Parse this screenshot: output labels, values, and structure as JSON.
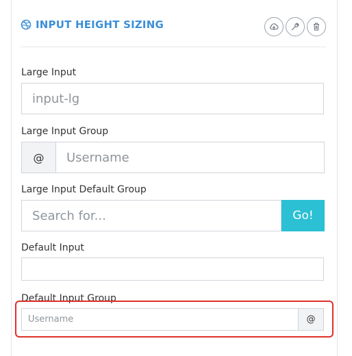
{
  "header": {
    "title": "INPUT HEIGHT SIZING",
    "icons": [
      "dribbble-icon",
      "cloud-upload-icon",
      "wrench-icon",
      "trash-icon"
    ]
  },
  "large_input": {
    "label": "Large Input",
    "placeholder": "input-lg"
  },
  "large_input_group": {
    "label": "Large Input Group",
    "addon": "@",
    "placeholder": "Username"
  },
  "large_default_group": {
    "label": "Large Input Default Group",
    "placeholder": "Search for...",
    "button": "Go!"
  },
  "default_input": {
    "label": "Default Input",
    "placeholder": ""
  },
  "default_input_group": {
    "label": "Default Input Group",
    "placeholder": "Username",
    "addon": "@"
  },
  "colors": {
    "accent": "#3d8fd6",
    "go_button": "#2bc0d3",
    "highlight": "#e0302a"
  }
}
